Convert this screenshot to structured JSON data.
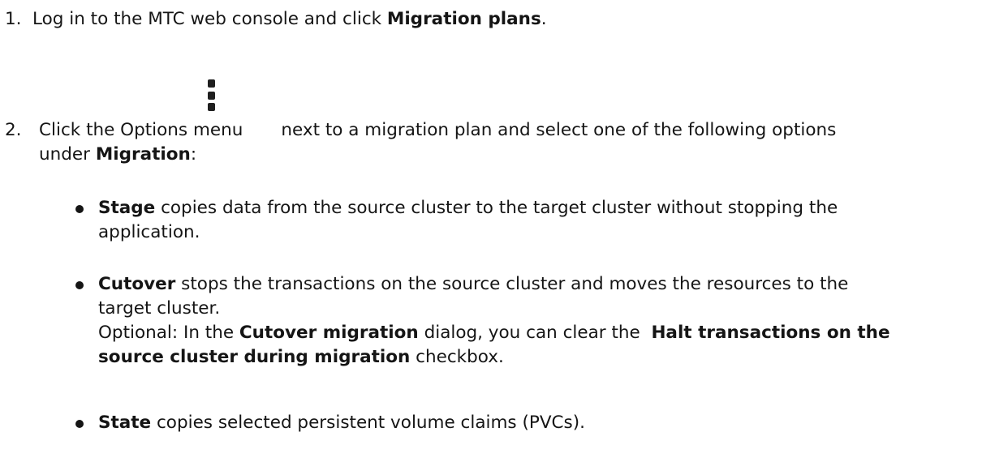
{
  "step1": {
    "number": "1.",
    "text_before": "Log in to the MTC web console and click ",
    "bold": "Migration plans",
    "text_after": "."
  },
  "step2": {
    "number": "2.",
    "text_before": "Click the Options menu",
    "text_after": "next to a migration plan and select one of the following options",
    "line2_before": "under ",
    "line2_bold": "Migration",
    "line2_after": ":",
    "icon": "kebab-menu-icon"
  },
  "options": [
    {
      "term": "Stage",
      "line1": " copies data from the source cluster to the target cluster without stopping the",
      "line2": "application."
    },
    {
      "term": "Cutover",
      "line1": " stops the transactions on the source cluster and moves the resources to the",
      "line2": "target cluster.",
      "note": {
        "prefix": "Optional: In the ",
        "bold1": "Cutover migration",
        "middle": " dialog, you can clear the  ",
        "bold2_line1": "Halt transactions on the",
        "bold2_line2": "source cluster during migration",
        "suffix": " checkbox."
      }
    },
    {
      "term": "State",
      "line1": " copies selected persistent volume claims (PVCs)."
    }
  ]
}
